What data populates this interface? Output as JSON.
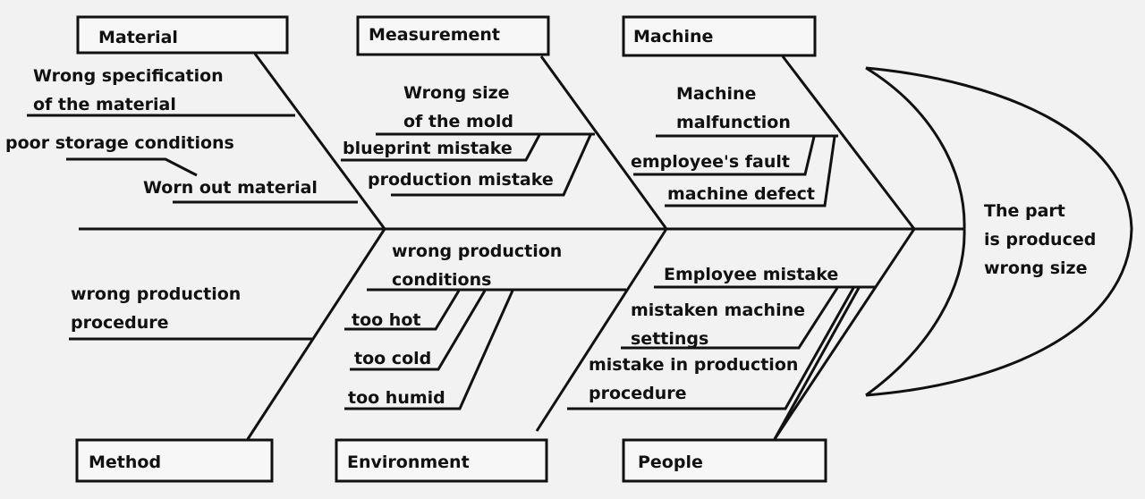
{
  "diagram": {
    "type": "fishbone",
    "effect": {
      "lines": [
        "The part",
        "is produced",
        "wrong size"
      ]
    },
    "categories": {
      "material": {
        "label": "Material",
        "causes": [
          {
            "lines": [
              "Wrong specification",
              "of the material"
            ]
          },
          {
            "lines": [
              "poor storage conditions"
            ]
          },
          {
            "lines": [
              "Worn out material"
            ]
          }
        ]
      },
      "measurement": {
        "label": "Measurement",
        "causes": [
          {
            "lines": [
              "Wrong size",
              "of the mold"
            ],
            "subcauses": [
              "blueprint mistake",
              "production mistake"
            ]
          }
        ]
      },
      "machine": {
        "label": "Machine",
        "causes": [
          {
            "lines": [
              "Machine",
              "malfunction"
            ],
            "subcauses": [
              "employee's fault",
              "machine defect"
            ]
          }
        ]
      },
      "method": {
        "label": "Method",
        "causes": [
          {
            "lines": [
              "wrong production",
              "procedure"
            ]
          }
        ]
      },
      "environment": {
        "label": "Environment",
        "causes": [
          {
            "lines": [
              "wrong production",
              "conditions"
            ],
            "subcauses": [
              "too hot",
              "too cold",
              "too humid"
            ]
          }
        ]
      },
      "people": {
        "label": "People",
        "causes": [
          {
            "lines": [
              "Employee  mistake"
            ],
            "subcauses": [
              {
                "lines": [
                  "mistaken machine",
                  "settings"
                ]
              },
              {
                "lines": [
                  "mistake in production",
                  "procedure"
                ]
              }
            ]
          }
        ]
      }
    }
  }
}
